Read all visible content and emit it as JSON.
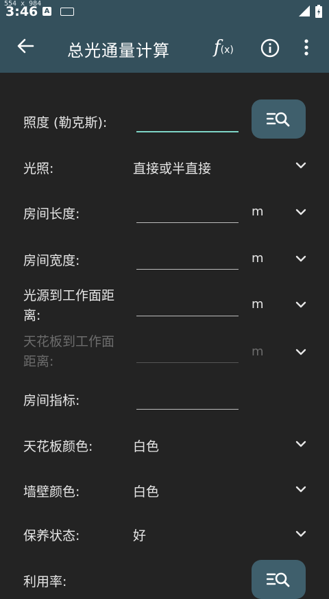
{
  "status_bar": {
    "dims_overlay": "554 x 984",
    "time": "3:46",
    "notification_letter": "A"
  },
  "app_bar": {
    "title": "总光通量计算",
    "fx_label": "f",
    "fx_sub": "(x)"
  },
  "form": {
    "illuminance_label": "照度 (勒克斯):",
    "lighting_label": "光照:",
    "lighting_value": "直接或半直接",
    "room_length_label": "房间长度:",
    "room_length_unit": "m",
    "room_width_label": "房间宽度:",
    "room_width_unit": "m",
    "light_distance_label": "光源到工作面距离:",
    "light_distance_unit": "m",
    "ceiling_distance_label": "天花板到工作面距离:",
    "ceiling_distance_unit": "m",
    "room_index_label": "房间指标:",
    "ceiling_color_label": "天花板颜色:",
    "ceiling_color_value": "白色",
    "wall_color_label": "墙壁颜色:",
    "wall_color_value": "白色",
    "maintenance_label": "保养状态:",
    "maintenance_value": "好",
    "utilization_label": "利用率:"
  },
  "colors": {
    "app_bar": "#34505c",
    "background": "#232323",
    "accent_underline": "#7fd6c8",
    "button": "#3f5f6c"
  },
  "icons": [
    "back-arrow-icon",
    "function-icon",
    "info-icon",
    "more-vert-icon",
    "chevron-down-icon",
    "list-search-icon"
  ]
}
